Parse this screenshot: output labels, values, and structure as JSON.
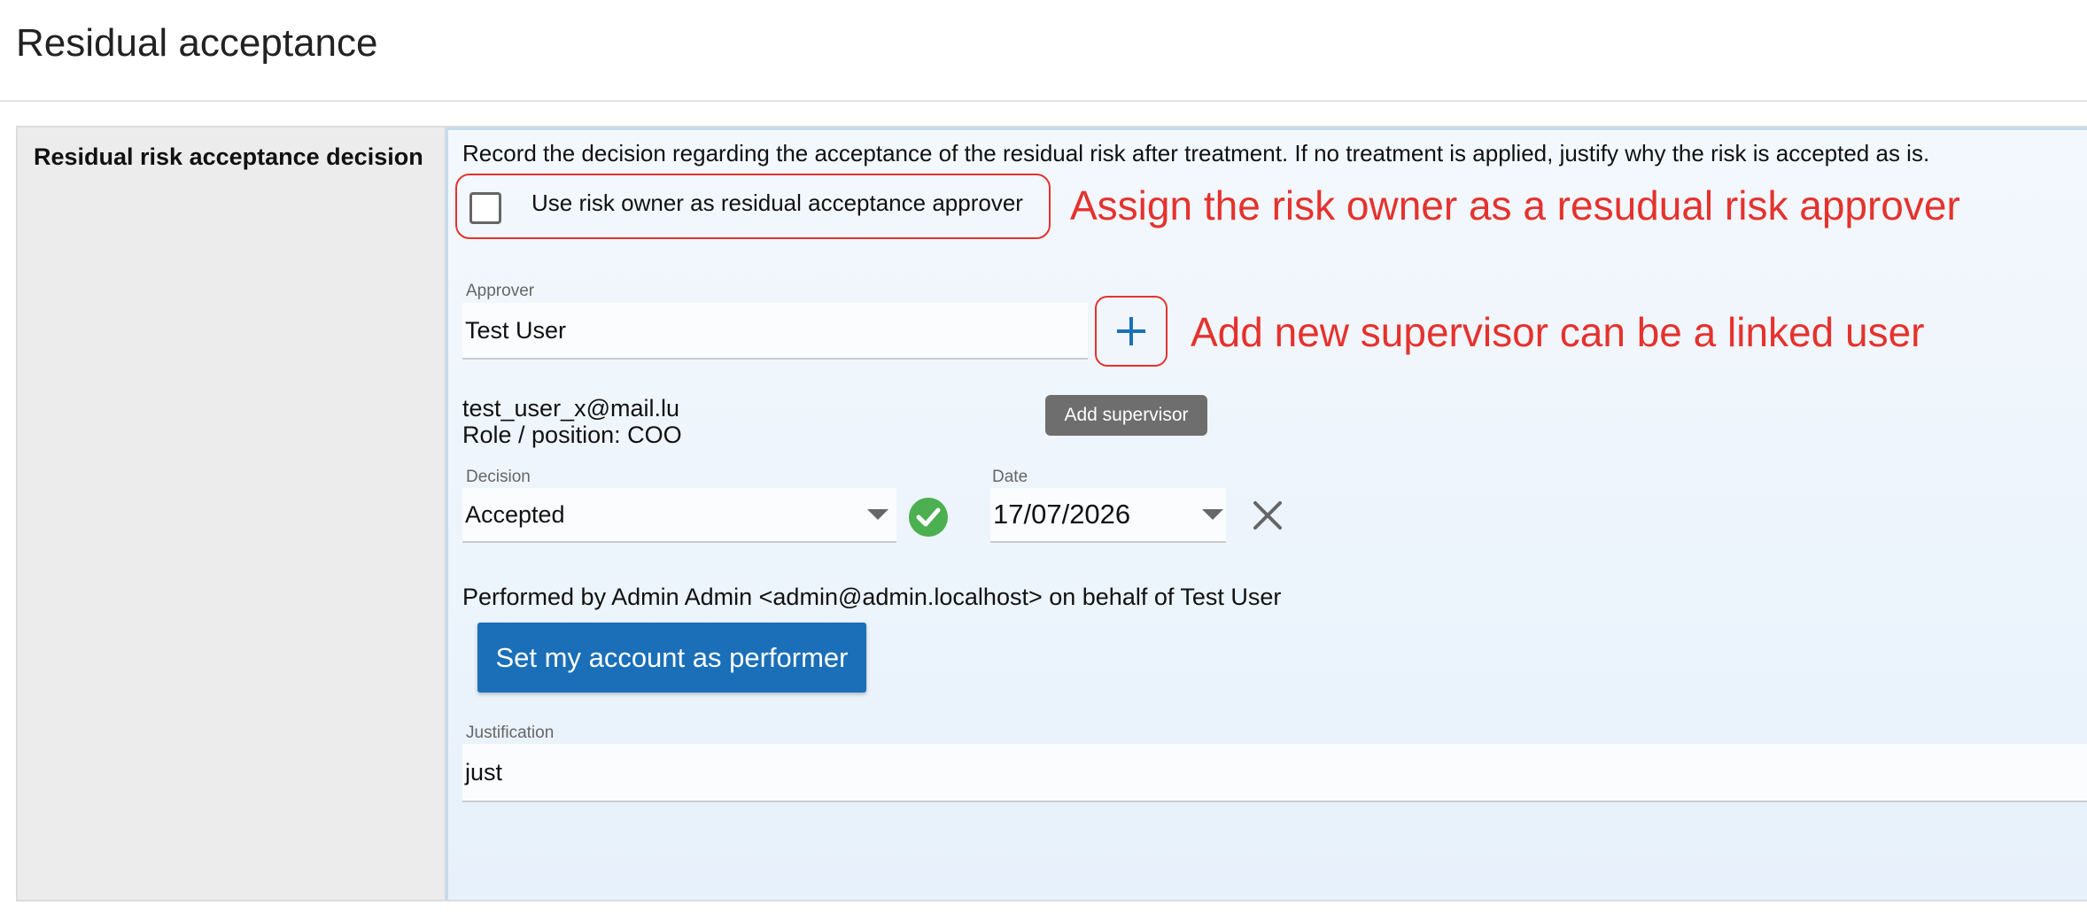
{
  "page": {
    "title": "Residual acceptance"
  },
  "row": {
    "label": "Residual risk acceptance decision",
    "instruction": "Record the decision regarding the acceptance of the residual risk after treatment. If no treatment is applied, justify why the risk is accepted as is."
  },
  "owner_approver": {
    "checked": false,
    "label": "Use risk owner as residual acceptance approver"
  },
  "approver": {
    "label": "Approver",
    "value": "Test User",
    "email": "test_user_x@mail.lu",
    "role": "Role / position: COO",
    "add_tooltip": "Add supervisor"
  },
  "decision": {
    "label": "Decision",
    "value": "Accepted",
    "status_icon": "check-circle-icon"
  },
  "date": {
    "label": "Date",
    "value": "17/07/2026"
  },
  "performer": {
    "text": "Performed by Admin Admin <admin@admin.localhost> on behalf of Test User",
    "button_label": "Set my account as performer"
  },
  "justification": {
    "label": "Justification",
    "value": "just"
  },
  "annotations": {
    "owner_note": "Assign the risk owner as a resudual risk approver",
    "supervisor_note": "Add new supervisor can be a linked user"
  },
  "colors": {
    "annotation": "#e5322d",
    "primary": "#1a6fb8",
    "success": "#4caf50"
  }
}
